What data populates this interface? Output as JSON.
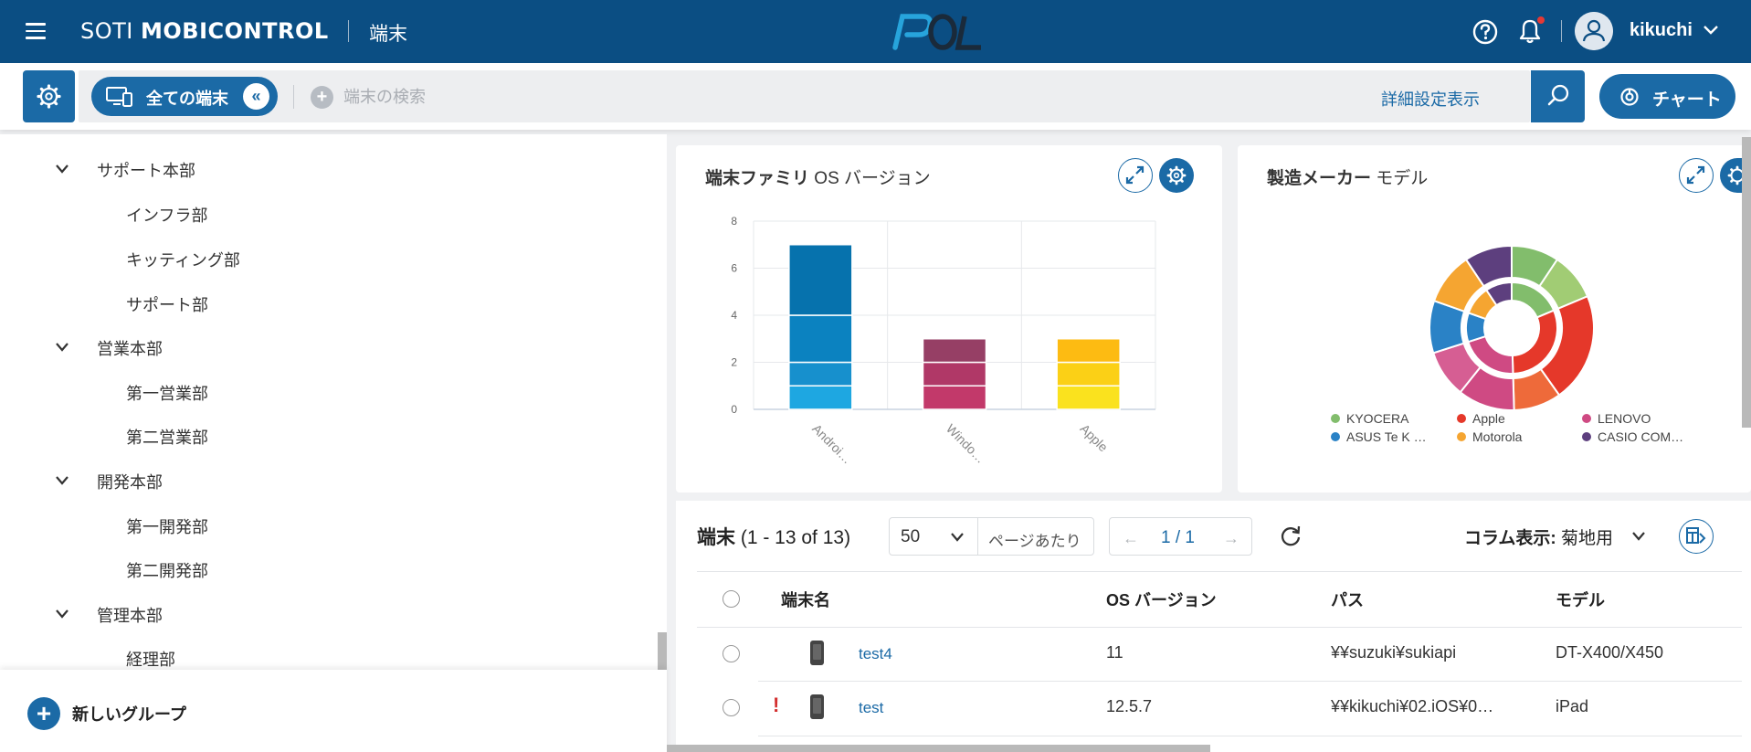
{
  "header": {
    "brand_light": "SOTI ",
    "brand_bold": "MOBICONTROL",
    "page_name": "端末",
    "logo_text": "POL",
    "username": "kikuchi",
    "icons": {
      "menu": "hamburger-icon",
      "help": "help-icon",
      "notifications": "bell-icon",
      "avatar": "user-icon",
      "dropdown": "chevron-down-icon"
    }
  },
  "toolbar": {
    "all_devices_label": "全ての端末",
    "collapse_label": "«",
    "search_placeholder": "端末の検索",
    "advanced_label": "詳細設定表示",
    "chart_label": "チャート"
  },
  "tree": {
    "items": [
      {
        "label": "サポート本部",
        "level": 0,
        "expanded": true
      },
      {
        "label": "インフラ部",
        "level": 1
      },
      {
        "label": "キッティング部",
        "level": 1
      },
      {
        "label": "サポート部",
        "level": 1
      },
      {
        "label": "営業本部",
        "level": 0,
        "expanded": true
      },
      {
        "label": "第一営業部",
        "level": 1
      },
      {
        "label": "第二営業部",
        "level": 1
      },
      {
        "label": "開発本部",
        "level": 0,
        "expanded": true
      },
      {
        "label": "第一開発部",
        "level": 1
      },
      {
        "label": "第二開発部",
        "level": 1
      },
      {
        "label": "管理本部",
        "level": 0,
        "expanded": true
      },
      {
        "label": "経理部",
        "level": 1
      }
    ],
    "new_group_label": "新しいグループ"
  },
  "card1": {
    "title_bold": "端末ファミリ",
    "title_rest": " OS バージョン"
  },
  "card2": {
    "title_bold": "製造メーカー",
    "title_rest": " モデル"
  },
  "chart_data": [
    {
      "type": "bar",
      "stacked": true,
      "categories": [
        "Androi…",
        "Windo…",
        "Apple"
      ],
      "totals": [
        7,
        3,
        3
      ],
      "segments": [
        {
          "category": "Androi…",
          "values": [
            1,
            1,
            2,
            3
          ],
          "colors": [
            "#1ea7e1",
            "#1790cd",
            "#0b82c0",
            "#0672ad"
          ]
        },
        {
          "category": "Windo…",
          "values": [
            1,
            1,
            1
          ],
          "colors": [
            "#c2396a",
            "#b03867",
            "#963f65"
          ]
        },
        {
          "category": "Apple",
          "values": [
            1,
            1,
            1
          ],
          "colors": [
            "#fae21e",
            "#fbd016",
            "#fdbb12"
          ]
        }
      ],
      "yticks": [
        0,
        2,
        4,
        6,
        8
      ],
      "ylim": [
        0,
        8
      ],
      "grid": true
    },
    {
      "type": "pie",
      "variant": "double-donut",
      "legend": [
        {
          "label": "KYOCERA",
          "color": "#82bd6c"
        },
        {
          "label": "Apple",
          "color": "#e5382a"
        },
        {
          "label": "LENOVO",
          "color": "#cf4a83"
        },
        {
          "label": "ASUS Te K …",
          "color": "#2a82c6"
        },
        {
          "label": "Motorola",
          "color": "#f5a531"
        },
        {
          "label": "CASIO COM…",
          "color": "#5d3f7e"
        }
      ],
      "outer_ring": [
        {
          "label": "KYOCERA",
          "value": 1,
          "color": "#82bd6c"
        },
        {
          "label": "KYOCERA",
          "value": 1,
          "color": "#a1cc74"
        },
        {
          "label": "Apple",
          "value": 2.3,
          "color": "#e5382a"
        },
        {
          "label": "Apple",
          "value": 1,
          "color": "#ee6a3a"
        },
        {
          "label": "LENOVO",
          "value": 1.2,
          "color": "#cf4a83"
        },
        {
          "label": "LENOVO",
          "value": 1,
          "color": "#d65e93"
        },
        {
          "label": "ASUS Te K …",
          "value": 1.1,
          "color": "#2a82c6"
        },
        {
          "label": "Motorola",
          "value": 1.1,
          "color": "#f5a531"
        },
        {
          "label": "CASIO COM…",
          "value": 1,
          "color": "#5d3f7e"
        }
      ],
      "inner_ring": [
        {
          "label": "KYOCERA",
          "value": 2,
          "color": "#82bd6c"
        },
        {
          "label": "Apple",
          "value": 3.3,
          "color": "#e5382a"
        },
        {
          "label": "LENOVO",
          "value": 2.2,
          "color": "#cf4a83"
        },
        {
          "label": "ASUS Te K …",
          "value": 1.1,
          "color": "#2a82c6"
        },
        {
          "label": "Motorola",
          "value": 1.1,
          "color": "#f5a531"
        },
        {
          "label": "CASIO COM…",
          "value": 1,
          "color": "#5d3f7e"
        }
      ]
    }
  ],
  "devices": {
    "title_bold": "端末",
    "count_text": " (1 - 13 of 13)",
    "per_page_value": "50",
    "per_page_label": "ページあたり",
    "pager_prev": "←",
    "pager_text": "1 / 1",
    "pager_next": "→",
    "column_display_label": "コラム表示:",
    "column_display_value": "菊地用",
    "columns": [
      "端末名",
      "OS バージョン",
      "パス",
      "モデル"
    ],
    "rows": [
      {
        "name": "test4",
        "os": "11",
        "path": "¥¥suzuki¥sukiapi",
        "model": "DT-X400/X450",
        "alert": ""
      },
      {
        "name": "test",
        "os": "12.5.7",
        "path": "¥¥kikuchi¥02.iOS¥0…",
        "model": "iPad",
        "alert": "!"
      }
    ]
  }
}
